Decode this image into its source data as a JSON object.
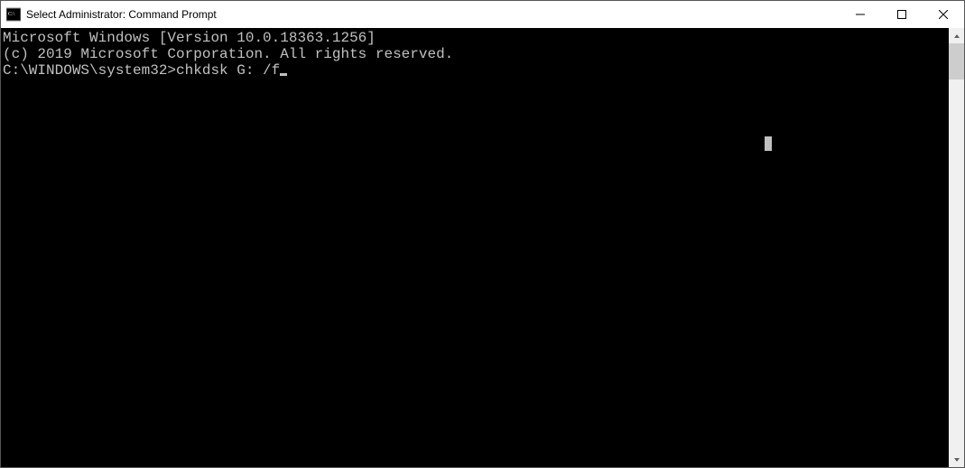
{
  "window": {
    "title": "Select Administrator: Command Prompt"
  },
  "terminal": {
    "lines": [
      "Microsoft Windows [Version 10.0.18363.1256]",
      "(c) 2019 Microsoft Corporation. All rights reserved.",
      "",
      ""
    ],
    "prompt": "C:\\WINDOWS\\system32>",
    "command": "chkdsk G: /f"
  }
}
